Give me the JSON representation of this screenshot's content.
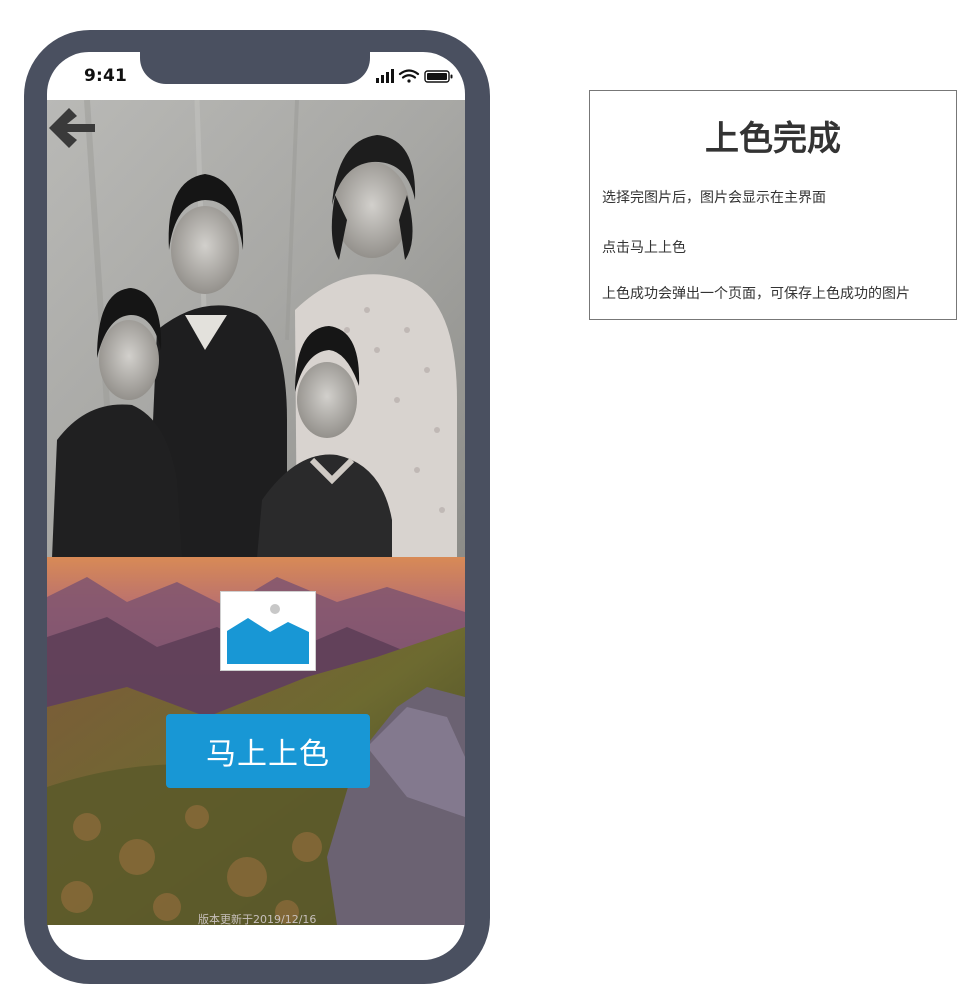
{
  "status_bar": {
    "time": "9:41"
  },
  "main": {
    "action_button_label": "马上上色",
    "version_text": "版本更新于2019/12/16"
  },
  "annotation": {
    "title": "上色完成",
    "lines": [
      "选择完图片后，图片会显示在主界面",
      "点击马上上色",
      "上色成功会弹出一个页面，可保存上色成功的图片"
    ]
  },
  "colors": {
    "frame": "#4a5060",
    "accent": "#1897d5",
    "text": "#333333"
  },
  "icons": [
    "back-arrow-icon",
    "image-placeholder-icon",
    "signal-icon",
    "wifi-icon",
    "battery-icon"
  ]
}
